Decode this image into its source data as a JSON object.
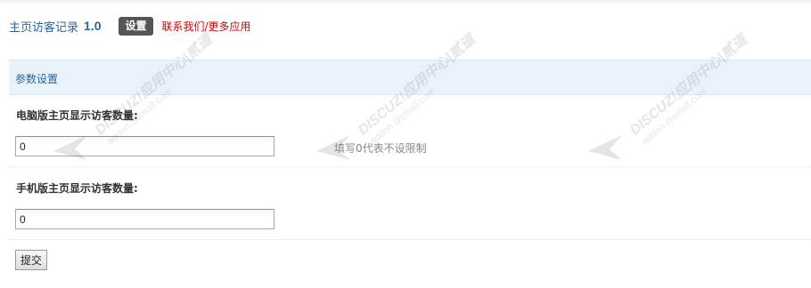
{
  "header": {
    "plugin_title": "主页访客记录",
    "plugin_version": "1.0",
    "tab_settings_label": "设置",
    "contact_link_label": "联系我们/更多应用"
  },
  "section": {
    "title": "参数设置"
  },
  "form": {
    "pc_field": {
      "label": "电脑版主页显示访客数量:",
      "value": "0",
      "hint": "填写0代表不设限制"
    },
    "mobile_field": {
      "label": "手机版主页显示访客数量:",
      "value": "0"
    },
    "submit_label": "提交"
  },
  "watermark": {
    "brand": "DISCUZ!应用中心|贰道",
    "url": "addon.dismall.com"
  }
}
